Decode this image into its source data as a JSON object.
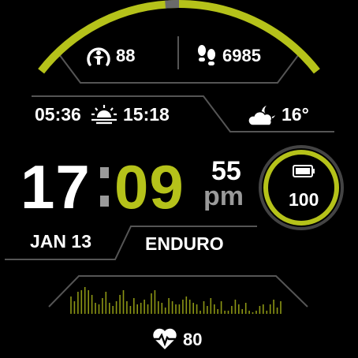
{
  "colors": {
    "accent": "#b5c21a",
    "accent_dim": "#8c9614",
    "frame": "#555555",
    "text": "#ffffff",
    "muted": "#9a9a9a",
    "ring_gray": "#6a6a6a"
  },
  "top_arc": {
    "progress": 0.5
  },
  "stats": {
    "readiness_value": "88",
    "readiness_icon": "readiness-gauge-icon",
    "steps_value": "6985",
    "steps_icon": "footprints-icon"
  },
  "sun": {
    "sunrise": "05:36",
    "sunset": "15:18",
    "icon": "sunrise-icon"
  },
  "weather": {
    "temperature": "16°",
    "icon": "partly-cloudy-night-icon"
  },
  "time": {
    "hours": "17",
    "separator": ":",
    "minutes": "09",
    "seconds": "55",
    "ampm": "pm"
  },
  "battery": {
    "value": "100",
    "icon": "battery-icon",
    "level": 1.0
  },
  "date": "JAN 13",
  "mode": "ENDURO",
  "heart": {
    "value": "80",
    "icon": "heart-rate-icon",
    "histogram": [
      22,
      16,
      28,
      30,
      34,
      30,
      24,
      14,
      12,
      20,
      28,
      14,
      10,
      16,
      24,
      30,
      16,
      10,
      20,
      12,
      14,
      18,
      12,
      26,
      30,
      16,
      14,
      8,
      20,
      16,
      12,
      12,
      18,
      22,
      18,
      14,
      12,
      4,
      16,
      10,
      20,
      12,
      6,
      16,
      4,
      4,
      10,
      18,
      12,
      6,
      14,
      4,
      2,
      4,
      10,
      12,
      4,
      12,
      18,
      8,
      16
    ]
  }
}
